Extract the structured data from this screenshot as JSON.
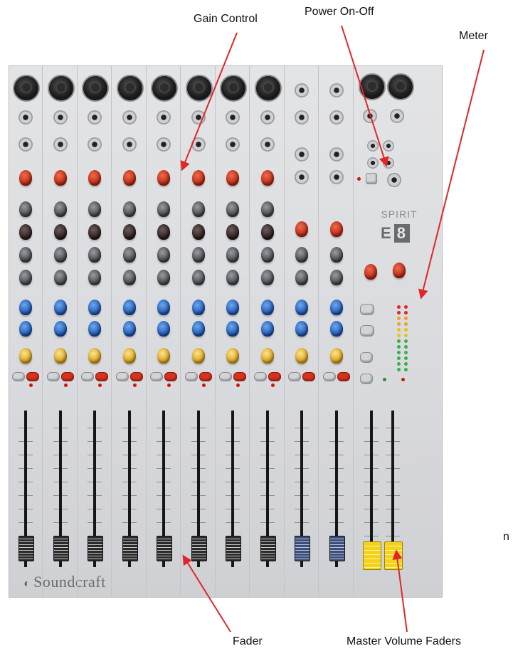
{
  "callouts": {
    "gain_control": "Gain Control",
    "power_on_off": "Power On-Off",
    "meter": "Meter",
    "fader": "Fader",
    "master_volume_faders": "Master Volume Faders",
    "cropped_edge_text": "n"
  },
  "mixer": {
    "brand": "Soundcraft",
    "model_line": "SPIRIT",
    "model_prefix": "E",
    "model_number": "8"
  },
  "colors": {
    "callout_arrow": "#e0262a",
    "panel": "#dcdde0",
    "knob_red": "#c8321a",
    "knob_blue": "#2d6fd0",
    "knob_yellow": "#f2c23a",
    "knob_grey": "#5b5c60",
    "master_fader_cap": "#f4d21a",
    "stereo_fader_cap": "#8aa0d0"
  },
  "icons": {
    "brand_logo": "soundcraft-logo-icon",
    "xlr_input": "xlr-connector-icon",
    "jack_input": "jack-socket-icon"
  }
}
